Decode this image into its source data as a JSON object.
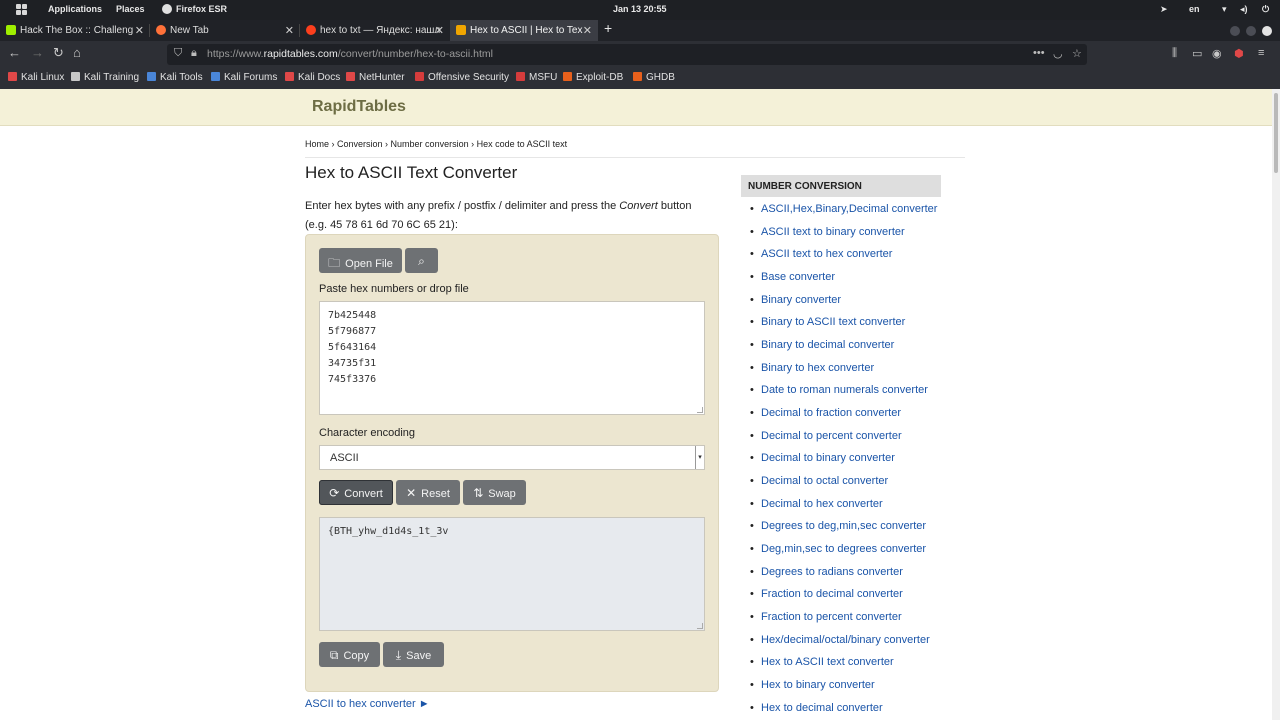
{
  "os": {
    "applications": "Applications",
    "places": "Places",
    "browser": "Firefox ESR",
    "clock": "Jan 13  20:55",
    "lang": "en"
  },
  "tabs": [
    {
      "label": "Hack The Box :: Challeng",
      "color": "#9fef00"
    },
    {
      "label": "New Tab",
      "color": "#ff7139"
    },
    {
      "label": "hex to txt — Яндекс: нашл",
      "color": "#fc3f1d"
    },
    {
      "label": "Hex to ASCII | Hex to Tex",
      "color": "#f0a500"
    }
  ],
  "url": {
    "prefix": "https://www.",
    "domain": "rapidtables.com",
    "path": "/convert/number/hex-to-ascii.html"
  },
  "bookmarks": [
    {
      "label": "Kali Linux",
      "color": "#e04848"
    },
    {
      "label": "Kali Training",
      "color": "#c8c8c8"
    },
    {
      "label": "Kali Tools",
      "color": "#4a86d8"
    },
    {
      "label": "Kali Forums",
      "color": "#4a86d8"
    },
    {
      "label": "Kali Docs",
      "color": "#e04848"
    },
    {
      "label": "NetHunter",
      "color": "#e04848"
    },
    {
      "label": "Offensive Security",
      "color": "#d63c3c"
    },
    {
      "label": "MSFU",
      "color": "#d63c3c"
    },
    {
      "label": "Exploit-DB",
      "color": "#e8601c"
    },
    {
      "label": "GHDB",
      "color": "#e8601c"
    }
  ],
  "site": {
    "logo": "RapidTables"
  },
  "breadcrumb": {
    "home": "Home",
    "sep": " › ",
    "conversion": "Conversion",
    "number": "Number conversion",
    "current": "Hex code to ASCII text"
  },
  "page": {
    "title": "Hex to ASCII Text Converter",
    "desc_before": "Enter hex bytes with any prefix / postfix / delimiter and press the ",
    "desc_em": "Convert",
    "desc_after": " button",
    "example": "(e.g. 45 78 61 6d 70 6C 65 21):"
  },
  "converter": {
    "open_file": "Open File",
    "input_label": "Paste hex numbers or drop file",
    "input_value": "7b425448\n5f796877\n5f643164\n34735f31\n745f3376",
    "encoding_label": "Character encoding",
    "encoding_value": "ASCII",
    "convert": "Convert",
    "reset": "Reset",
    "swap": "Swap",
    "output_value": "{BTH_yhw_d1d4s_1t_3v",
    "copy": "Copy",
    "save": "Save"
  },
  "bottom_link": "ASCII to hex converter ►",
  "sidebar": {
    "heading": "NUMBER CONVERSION",
    "items": [
      "ASCII,Hex,Binary,Decimal converter",
      "ASCII text to binary converter",
      "ASCII text to hex converter",
      "Base converter",
      "Binary converter",
      "Binary to ASCII text converter",
      "Binary to decimal converter",
      "Binary to hex converter",
      "Date to roman numerals converter",
      "Decimal to fraction converter",
      "Decimal to percent converter",
      "Decimal to binary converter",
      "Decimal to octal converter",
      "Decimal to hex converter",
      "Degrees to deg,min,sec converter",
      "Deg,min,sec to degrees converter",
      "Degrees to radians converter",
      "Fraction to decimal converter",
      "Fraction to percent converter",
      "Hex/decimal/octal/binary converter",
      "Hex to ASCII text converter",
      "Hex to binary converter",
      "Hex to decimal converter"
    ]
  }
}
